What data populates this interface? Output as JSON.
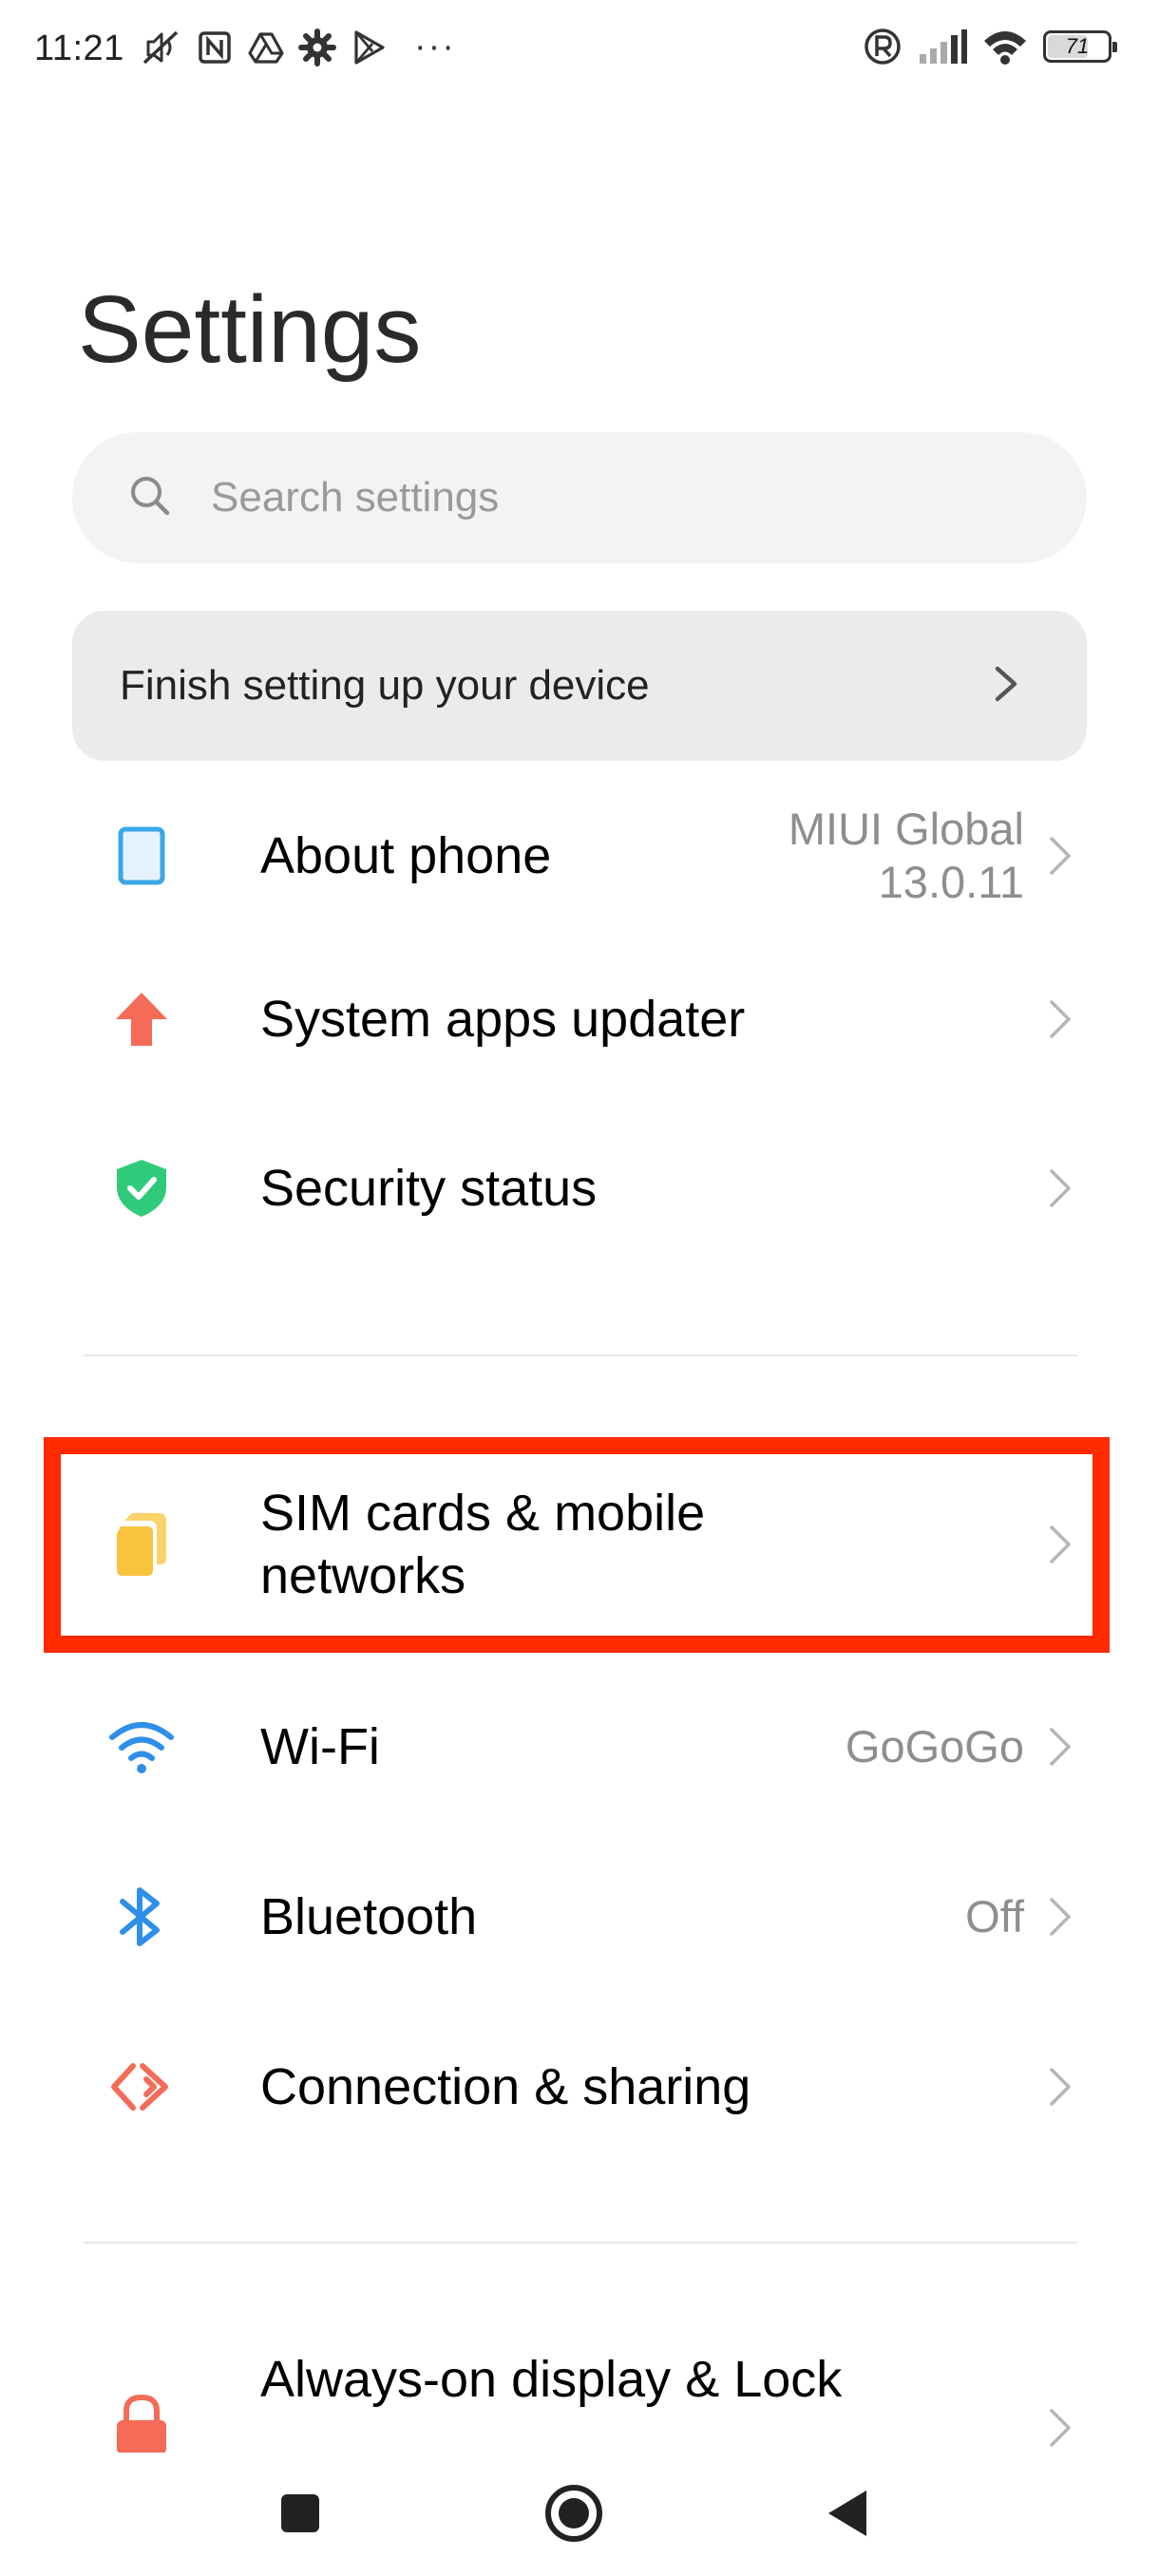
{
  "status_bar": {
    "time": "11:21",
    "overflow": "···",
    "battery_percent": "71",
    "left_icons": [
      "mute-icon",
      "nfc-icon",
      "drive-icon",
      "gear-icon",
      "play-store-icon"
    ],
    "right_icons": [
      "registered-icon",
      "signal-icon",
      "wifi-icon",
      "battery-icon"
    ]
  },
  "header": {
    "title": "Settings"
  },
  "search": {
    "placeholder": "Search settings",
    "value": ""
  },
  "setup_card": {
    "label": "Finish setting up your device"
  },
  "sections": [
    {
      "items": [
        {
          "label": "About phone",
          "value": [
            "MIUI Global",
            "13.0.11"
          ],
          "icon": "phone-icon",
          "color": "#3aa6e8"
        },
        {
          "label": "System apps updater",
          "value": [],
          "icon": "arrow-up-icon",
          "color": "#f46b57"
        },
        {
          "label": "Security status",
          "value": [],
          "icon": "shield-check-icon",
          "color": "#2fcb7b"
        }
      ]
    },
    {
      "items": [
        {
          "label": [
            "SIM cards & mobile",
            "networks"
          ],
          "value": [],
          "icon": "sim-card-icon",
          "color": "#f9c33d"
        },
        {
          "label": "Wi-Fi",
          "value": [
            "GoGoGo"
          ],
          "icon": "wifi-icon",
          "color": "#2f8fe8"
        },
        {
          "label": "Bluetooth",
          "value": [
            "Off"
          ],
          "icon": "bluetooth-icon",
          "color": "#2f8fe8"
        },
        {
          "label": "Connection & sharing",
          "value": [],
          "icon": "connection-icon",
          "color": "#f46b57"
        }
      ]
    },
    {
      "items": [
        {
          "label": "Always-on display & Lock",
          "value": [],
          "icon": "lock-icon",
          "color": "#f46b57"
        }
      ]
    }
  ],
  "highlight": {
    "color": "#ff2a00"
  },
  "nav_bar": {
    "buttons": [
      "recents-button",
      "home-button",
      "back-button"
    ]
  }
}
